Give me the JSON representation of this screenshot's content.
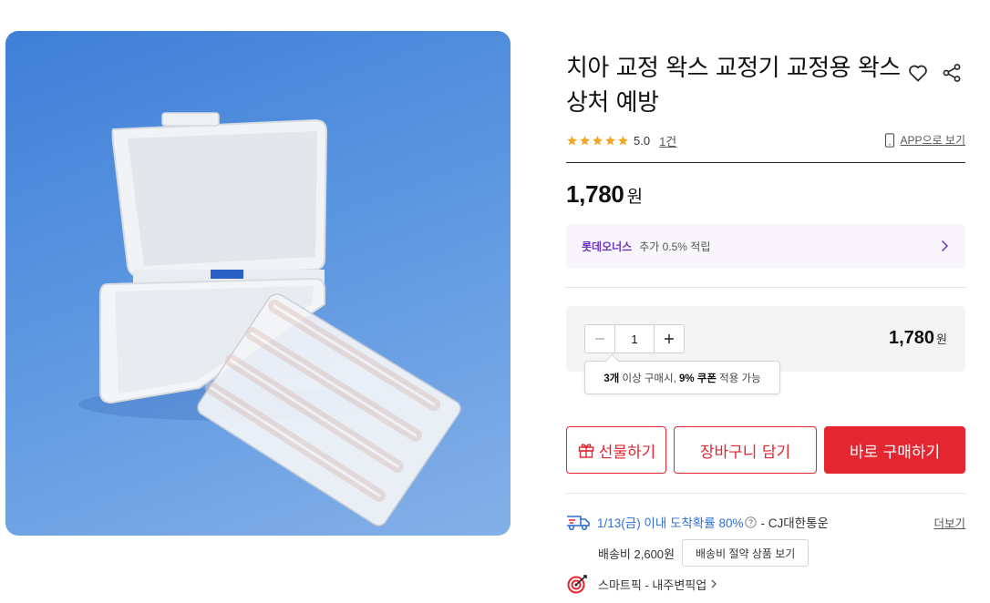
{
  "product": {
    "title": "치아 교정 왁스 교정기 교정용 왁스 상처 예방",
    "rating_score": "5.0",
    "review_count": "1건",
    "app_link": "APP으로 보기",
    "price": "1,780",
    "price_unit": "원"
  },
  "points": {
    "brand": "롯데오너스",
    "text": "추가 0.5% 적립"
  },
  "quantity": {
    "value": "1",
    "total": "1,780",
    "total_unit": "원"
  },
  "coupon_tip": {
    "qty": "3개",
    "text_a": " 이상 구매시, ",
    "pct": "9%",
    "coupon": " 쿠폰",
    "text_b": " 적용 가능"
  },
  "buttons": {
    "gift": "선물하기",
    "cart": "장바구니 담기",
    "buy": "바로 구매하기"
  },
  "delivery": {
    "date_text": "1/13(금) 이내 도착확률 80%",
    "carrier": "- CJ대한통운",
    "more": "더보기",
    "shipping_fee": "배송비 2,600원",
    "save_button": "배송비 절약 상품 보기",
    "pickup": "스마트픽 - 내주변픽업"
  },
  "colors": {
    "accent_red": "#e3262f",
    "star": "#f5a623",
    "points_purple": "#6c35b8",
    "delivery_blue": "#2f6fd8"
  },
  "icons": [
    "heart-icon",
    "share-icon",
    "star-icon",
    "phone-icon",
    "chevron-right-icon",
    "minus-icon",
    "plus-icon",
    "gift-icon",
    "truck-icon",
    "help-icon",
    "target-icon"
  ]
}
